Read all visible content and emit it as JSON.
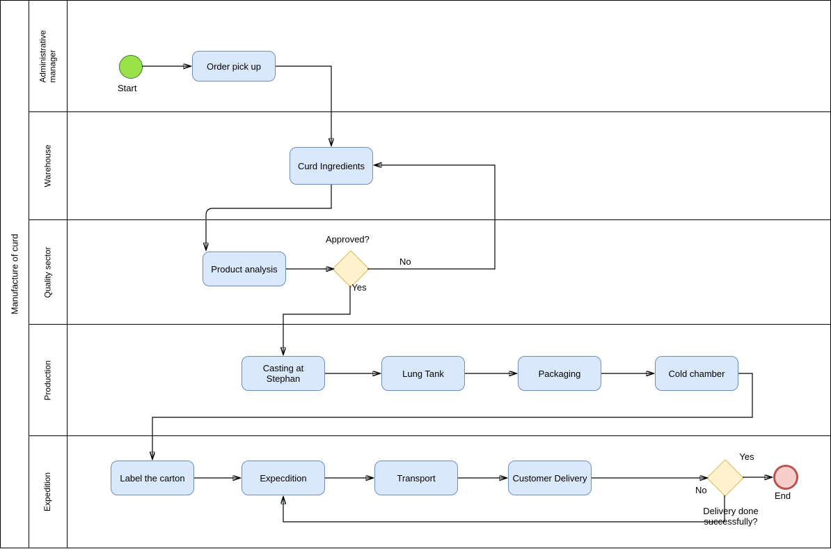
{
  "pool": {
    "title": "Manufacture of curd"
  },
  "lanes": {
    "admin": "Administrative\nmanager",
    "warehouse": "Warehouse",
    "quality": "Quality sector",
    "production": "Production",
    "expedition": "Expedition"
  },
  "nodes": {
    "start": "Start",
    "order_pickup": "Order pick up",
    "curd_ingredients": "Curd Ingredients",
    "product_analysis": "Product analysis",
    "approved_q": "Approved?",
    "yes": "Yes",
    "no": "No",
    "casting": "Casting at Stephan",
    "lung_tank": "Lung Tank",
    "packaging": "Packaging",
    "cold_chamber": "Cold chamber",
    "label_carton": "Label the carton",
    "expedition_b": "Expecdition",
    "transport": "Transport",
    "customer_delivery": "Customer Delivery",
    "delivery_q": "Delivery done successfully?",
    "end": "End"
  }
}
